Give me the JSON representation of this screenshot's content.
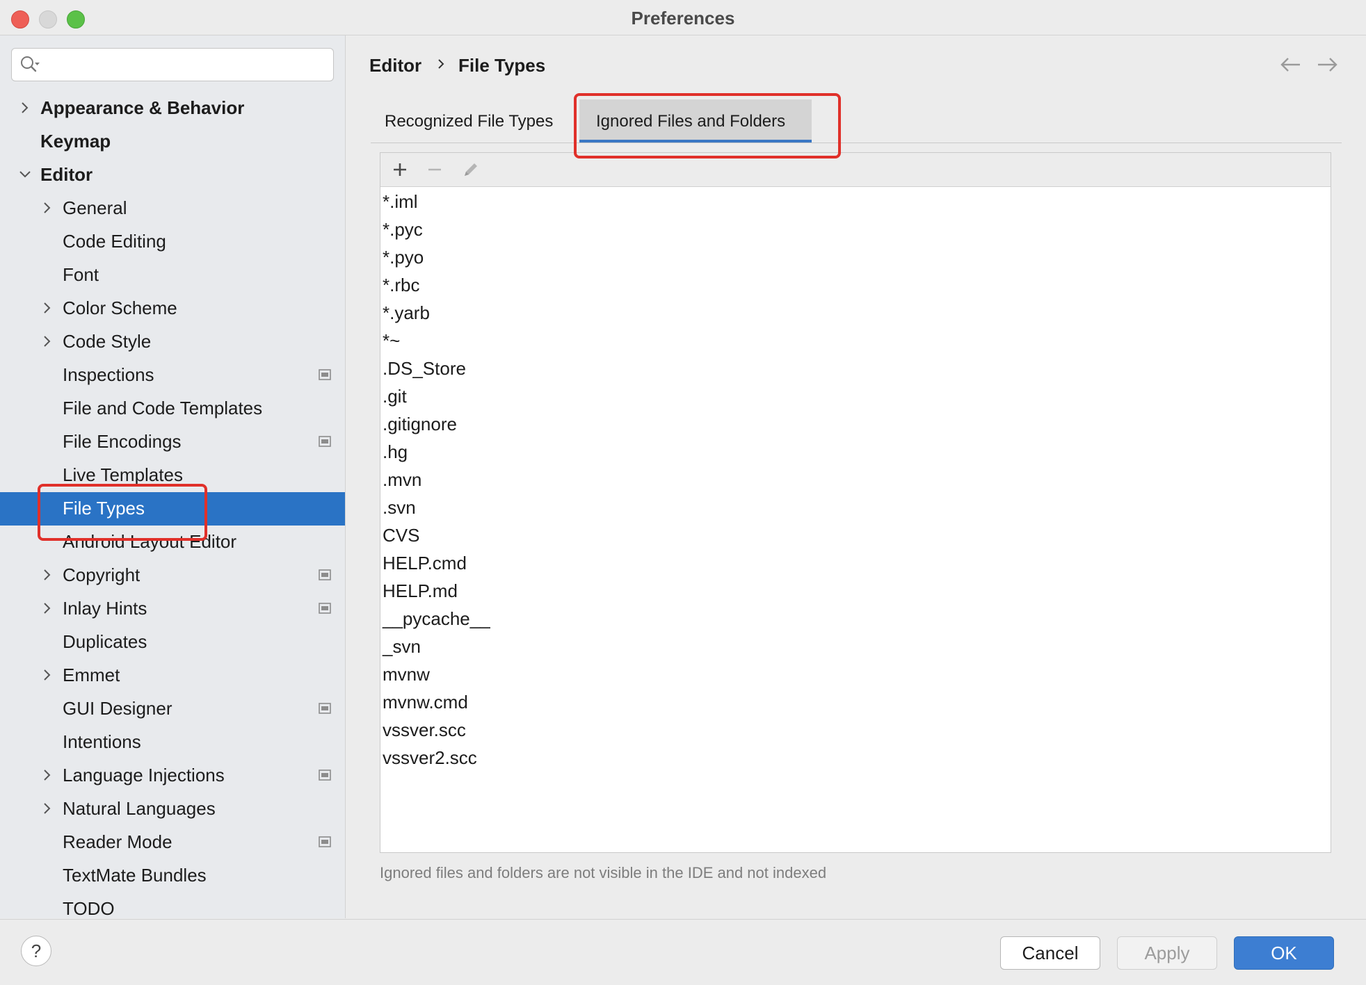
{
  "window": {
    "title": "Preferences"
  },
  "sidebar": {
    "search": {
      "value": "",
      "placeholder": ""
    },
    "items": [
      {
        "label": "Appearance & Behavior",
        "level": 0,
        "expandable": true,
        "expanded": false,
        "bold": true
      },
      {
        "label": "Keymap",
        "level": 0,
        "expandable": false,
        "bold": true
      },
      {
        "label": "Editor",
        "level": 0,
        "expandable": true,
        "expanded": true,
        "bold": true
      },
      {
        "label": "General",
        "level": 1,
        "expandable": true
      },
      {
        "label": "Code Editing",
        "level": 1
      },
      {
        "label": "Font",
        "level": 1
      },
      {
        "label": "Color Scheme",
        "level": 1,
        "expandable": true
      },
      {
        "label": "Code Style",
        "level": 1,
        "expandable": true
      },
      {
        "label": "Inspections",
        "level": 1,
        "project_icon": true
      },
      {
        "label": "File and Code Templates",
        "level": 1
      },
      {
        "label": "File Encodings",
        "level": 1,
        "project_icon": true
      },
      {
        "label": "Live Templates",
        "level": 1
      },
      {
        "label": "File Types",
        "level": 1,
        "selected": true
      },
      {
        "label": "Android Layout Editor",
        "level": 1
      },
      {
        "label": "Copyright",
        "level": 1,
        "expandable": true,
        "project_icon": true
      },
      {
        "label": "Inlay Hints",
        "level": 1,
        "expandable": true,
        "project_icon": true
      },
      {
        "label": "Duplicates",
        "level": 1
      },
      {
        "label": "Emmet",
        "level": 1,
        "expandable": true
      },
      {
        "label": "GUI Designer",
        "level": 1,
        "project_icon": true
      },
      {
        "label": "Intentions",
        "level": 1
      },
      {
        "label": "Language Injections",
        "level": 1,
        "expandable": true,
        "project_icon": true
      },
      {
        "label": "Natural Languages",
        "level": 1,
        "expandable": true
      },
      {
        "label": "Reader Mode",
        "level": 1,
        "project_icon": true
      },
      {
        "label": "TextMate Bundles",
        "level": 1
      },
      {
        "label": "TODO",
        "level": 1
      }
    ]
  },
  "breadcrumb": {
    "parent": "Editor",
    "current": "File Types"
  },
  "tabs": [
    {
      "label": "Recognized File Types",
      "active": false
    },
    {
      "label": "Ignored Files and Folders",
      "active": true
    }
  ],
  "ignored_list": {
    "toolbar": [
      "plus-icon",
      "minus-icon",
      "pencil-icon"
    ],
    "items": [
      "*.iml",
      "*.pyc",
      "*.pyo",
      "*.rbc",
      "*.yarb",
      "*~",
      ".DS_Store",
      ".git",
      ".gitignore",
      ".hg",
      ".mvn",
      ".svn",
      "CVS",
      "HELP.cmd",
      "HELP.md",
      "__pycache__",
      "_svn",
      "mvnw",
      "mvnw.cmd",
      "vssver.scc",
      "vssver2.scc"
    ],
    "hint": "Ignored files and folders are not visible in the IDE and not indexed"
  },
  "footer": {
    "help": "?",
    "cancel": "Cancel",
    "apply": "Apply",
    "ok": "OK"
  },
  "colors": {
    "selection": "#2a73c5",
    "ok_button": "#3d7ed2",
    "tab_underline": "#3a77c4",
    "highlight": "#e0302a"
  }
}
